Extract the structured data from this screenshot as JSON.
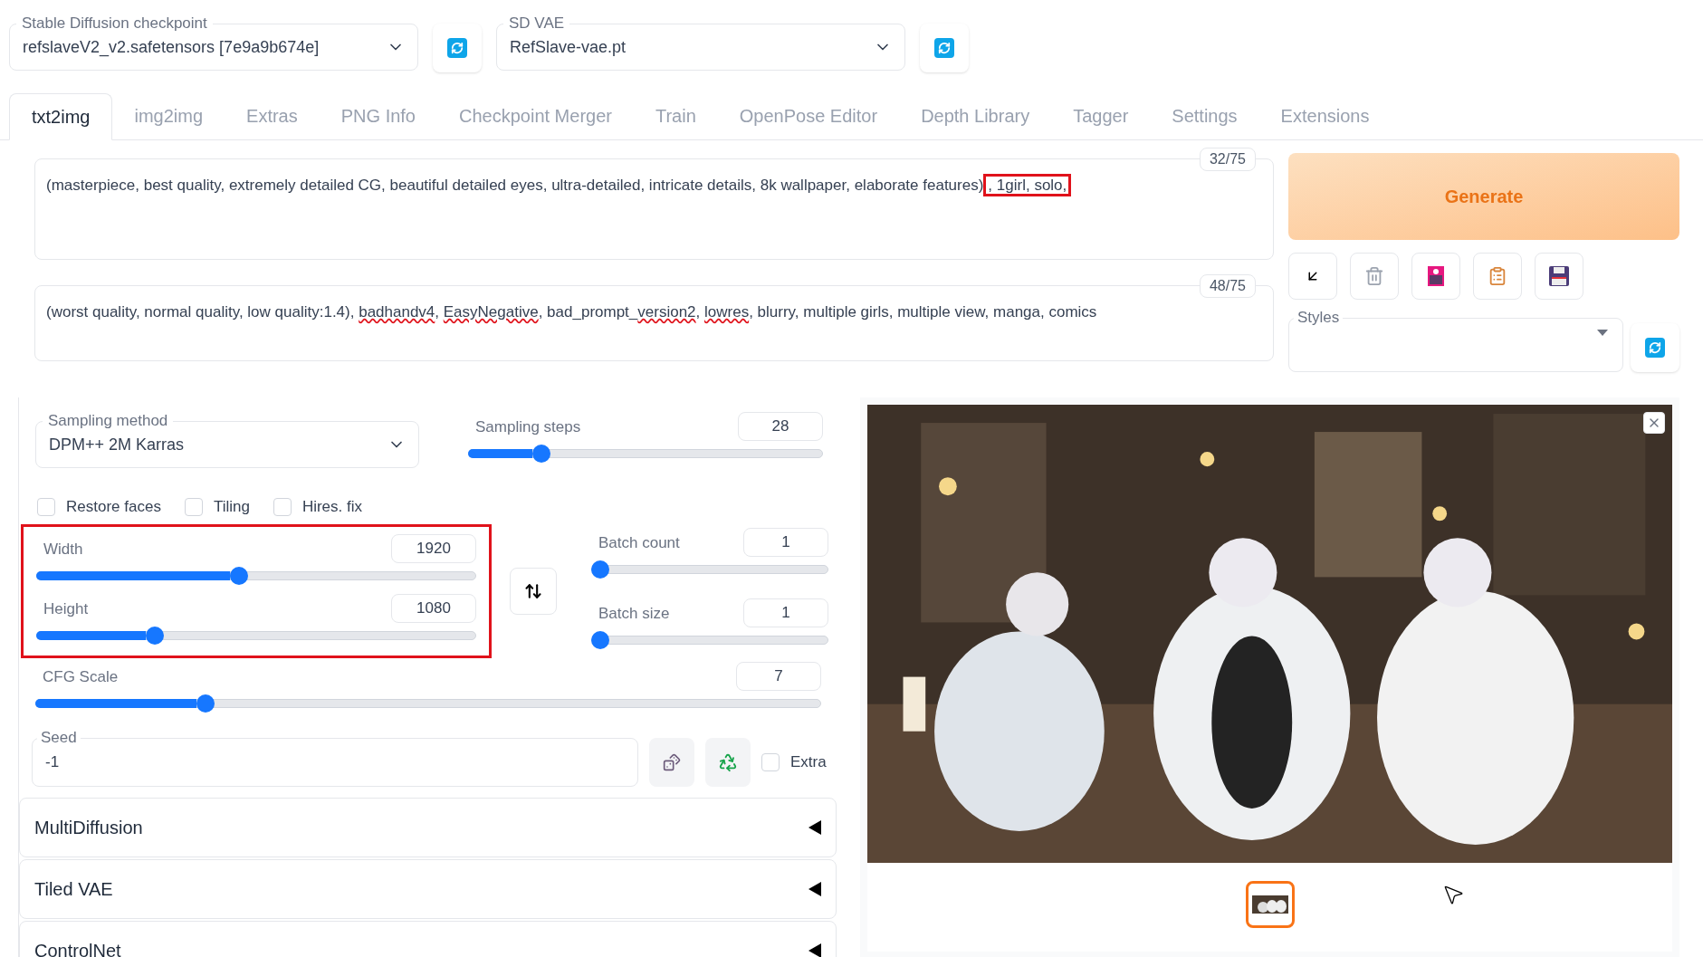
{
  "checkpoint": {
    "label": "Stable Diffusion checkpoint",
    "value": "refslaveV2_v2.safetensors [7e9a9b674e]"
  },
  "vae": {
    "label": "SD VAE",
    "value": "RefSlave-vae.pt"
  },
  "tabs": [
    {
      "label": "txt2img",
      "selected": true
    },
    {
      "label": "img2img",
      "selected": false
    },
    {
      "label": "Extras",
      "selected": false
    },
    {
      "label": "PNG Info",
      "selected": false
    },
    {
      "label": "Checkpoint Merger",
      "selected": false
    },
    {
      "label": "Train",
      "selected": false
    },
    {
      "label": "OpenPose Editor",
      "selected": false
    },
    {
      "label": "Depth Library",
      "selected": false
    },
    {
      "label": "Tagger",
      "selected": false
    },
    {
      "label": "Settings",
      "selected": false
    },
    {
      "label": "Extensions",
      "selected": false
    }
  ],
  "prompt": {
    "text": "(masterpiece, best quality, extremely detailed CG, beautiful detailed eyes, ultra-detailed, intricate details, 8k wallpaper, elaborate features)",
    "highlight": ", 1girl, solo,",
    "count": "32/75"
  },
  "negative_prompt": {
    "count": "48/75",
    "segments": [
      {
        "text": "(worst quality, normal quality, low quality:1.4), ",
        "misspelled": false
      },
      {
        "text": "badhandv4",
        "misspelled": true
      },
      {
        "text": ", ",
        "misspelled": false
      },
      {
        "text": "EasyNegative",
        "misspelled": true
      },
      {
        "text": ", bad_prompt_",
        "misspelled": false
      },
      {
        "text": "version2",
        "misspelled": true
      },
      {
        "text": ", ",
        "misspelled": false
      },
      {
        "text": "lowres",
        "misspelled": true
      },
      {
        "text": ", blurry, multiple girls, multiple view, manga, comics",
        "misspelled": false
      }
    ]
  },
  "generate": {
    "label": "Generate"
  },
  "styles": {
    "label": "Styles"
  },
  "sampling_method": {
    "label": "Sampling method",
    "value": "DPM++ 2M Karras"
  },
  "sampling_steps": {
    "label": "Sampling steps",
    "value": "28",
    "level": 0.19
  },
  "checkboxes": [
    {
      "label": "Restore faces",
      "checked": false
    },
    {
      "label": "Tiling",
      "checked": false
    },
    {
      "label": "Hires. fix",
      "checked": false
    }
  ],
  "width": {
    "label": "Width",
    "value": "1920",
    "level": 0.46
  },
  "height": {
    "label": "Height",
    "value": "1080",
    "level": 0.26
  },
  "batch_count": {
    "label": "Batch count",
    "value": "1",
    "level": 0
  },
  "batch_size": {
    "label": "Batch size",
    "value": "1",
    "level": 0
  },
  "cfg_scale": {
    "label": "CFG Scale",
    "value": "7",
    "level": 0.21
  },
  "seed": {
    "label": "Seed",
    "value": "-1",
    "extra": {
      "label": "Extra",
      "checked": false
    }
  },
  "accordions": [
    {
      "label": "MultiDiffusion",
      "expanded": false
    },
    {
      "label": "Tiled VAE",
      "expanded": false
    },
    {
      "label": "ControlNet",
      "expanded": false
    }
  ],
  "gallery": {
    "thumbnails": [
      {
        "selected": true
      }
    ]
  }
}
